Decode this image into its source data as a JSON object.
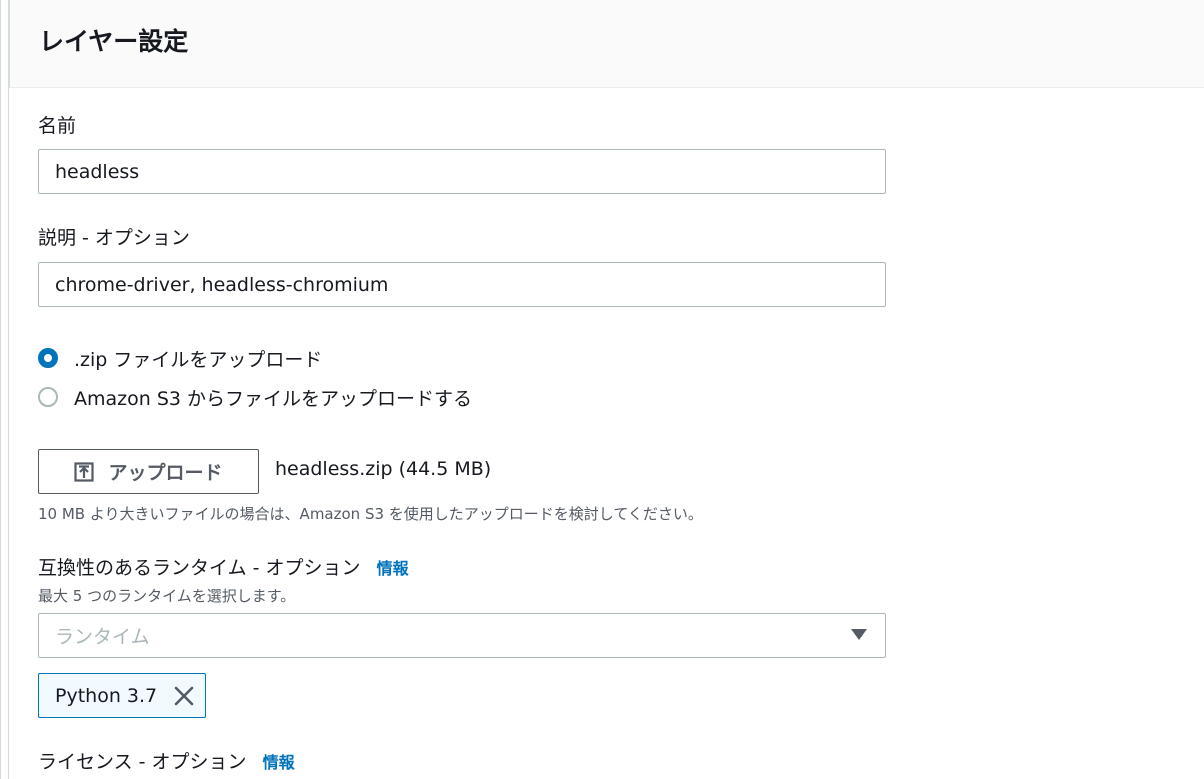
{
  "panel": {
    "title": "レイヤー設定"
  },
  "name_field": {
    "label": "名前",
    "value": "headless"
  },
  "description_field": {
    "label": "説明 - オプション",
    "value": "chrome-driver, headless-chromium"
  },
  "upload_source": {
    "options": [
      {
        "label": ".zip ファイルをアップロード",
        "selected": true
      },
      {
        "label": "Amazon S3 からファイルをアップロードする",
        "selected": false
      }
    ]
  },
  "upload": {
    "button_label": "アップロード",
    "icon": "upload-icon",
    "file_name": "headless.zip (44.5 MB)",
    "hint": "10 MB より大きいファイルの場合は、Amazon S3 を使用したアップロードを検討してください。"
  },
  "runtimes": {
    "label": "互換性のあるランタイム - オプション",
    "info": "情報",
    "description": "最大 5 つのランタイムを選択します。",
    "placeholder": "ランタイム",
    "selected": [
      {
        "label": "Python 3.7"
      }
    ]
  },
  "license": {
    "label": "ライセンス - オプション",
    "info": "情報"
  },
  "colors": {
    "accent": "#0073bb",
    "border": "#aab7b8",
    "text": "#16191f",
    "secondary_text": "#545b64",
    "header_bg": "#fafafa",
    "token_bg": "#f1faff"
  }
}
